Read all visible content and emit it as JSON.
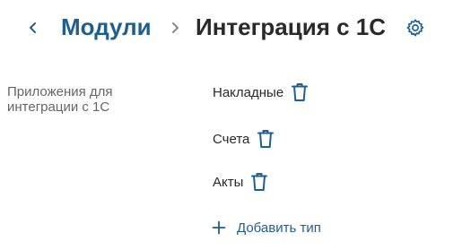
{
  "header": {
    "back_icon": "chevron-left-icon",
    "breadcrumb_parent": "Модули",
    "separator_icon": "chevron-right-icon",
    "title": "Интеграция с 1С",
    "settings_icon": "gear-icon"
  },
  "field": {
    "label": "Приложения для интеграции с 1С",
    "items": [
      {
        "label": "Накладные",
        "icon": "trash-icon"
      },
      {
        "label": "Счета",
        "icon": "trash-icon"
      },
      {
        "label": "Акты",
        "icon": "trash-icon"
      }
    ],
    "add_label": "Добавить тип",
    "add_icon": "plus-icon"
  },
  "colors": {
    "accent": "#1f5f8f",
    "text": "#2a2a2a",
    "muted": "#666666",
    "separator": "#888888"
  }
}
